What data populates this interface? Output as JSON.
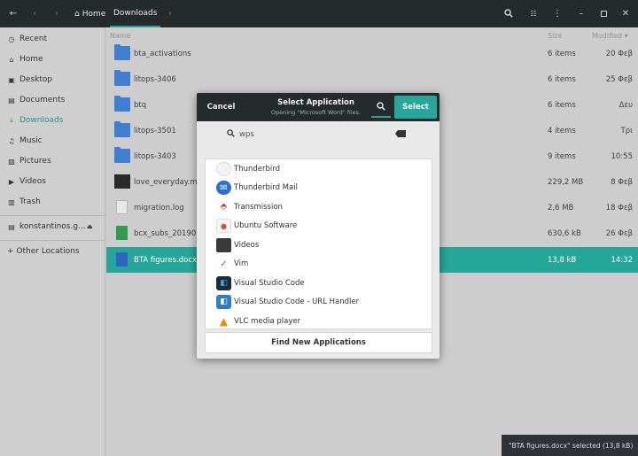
{
  "header": {
    "back_icon": "arrow-left-icon",
    "forward_icon": "arrow-right-icon",
    "crumbs": [
      "Home",
      "Downloads"
    ],
    "actions": [
      "search-icon",
      "view-toggle-icon",
      "menu-icon",
      "minimize-icon",
      "maximize-icon",
      "close-icon"
    ]
  },
  "sidebar": {
    "items": [
      {
        "label": "Recent",
        "icon": "clock-icon"
      },
      {
        "label": "Home",
        "icon": "home-icon"
      },
      {
        "label": "Desktop",
        "icon": "desktop-icon"
      },
      {
        "label": "Documents",
        "icon": "documents-icon"
      },
      {
        "label": "Downloads",
        "icon": "download-icon"
      },
      {
        "label": "Music",
        "icon": "music-icon"
      },
      {
        "label": "Pictures",
        "icon": "pictures-icon"
      },
      {
        "label": "Videos",
        "icon": "videos-icon"
      },
      {
        "label": "Trash",
        "icon": "trash-icon"
      }
    ],
    "drive": {
      "label": "konstantinos.g...",
      "icon": "drive-icon",
      "eject_icon": "eject-icon"
    },
    "other": {
      "label": "+ Other Locations"
    }
  },
  "filelist": {
    "columns": {
      "name": "Name",
      "size": "Size",
      "modified": "Modified ▾"
    },
    "rows": [
      {
        "name": "bta_activations",
        "size": "6 items",
        "modified": "20 Φεβ",
        "kind": "folder"
      },
      {
        "name": "litops-3406",
        "size": "6 items",
        "modified": "25 Φεβ",
        "kind": "folder"
      },
      {
        "name": "btq",
        "size": "6 items",
        "modified": "Δευ",
        "kind": "folder"
      },
      {
        "name": "litops-3501",
        "size": "4 items",
        "modified": "Τρι",
        "kind": "folder"
      },
      {
        "name": "litops-3403",
        "size": "9 items",
        "modified": "10:55",
        "kind": "folder"
      },
      {
        "name": "love_everyday.mp",
        "size": "229,2 MB",
        "modified": "8 Φεβ",
        "kind": "video"
      },
      {
        "name": "migration.log",
        "size": "2,6 MB",
        "modified": "18 Φεβ",
        "kind": "log"
      },
      {
        "name": "bcx_subs_20190",
        "size": "630,6 kB",
        "modified": "26 Φεβ",
        "kind": "sheet"
      },
      {
        "name": "BTA figures.docx",
        "size": "13,8 kB",
        "modified": "14:32",
        "kind": "docx",
        "selected": true
      }
    ]
  },
  "status": "\"BTA figures.docx\" selected  (13,8 kB)",
  "dialog": {
    "cancel": "Cancel",
    "title": "Select Application",
    "subtitle": "Opening \"Microsoft Word\" files.",
    "select": "Select",
    "search_value": "wps",
    "apps": [
      {
        "name": "Thunderbird",
        "icon": "thunderbird-icon"
      },
      {
        "name": "Thunderbird Mail",
        "icon": "thunderbird-mail-icon"
      },
      {
        "name": "Transmission",
        "icon": "transmission-icon"
      },
      {
        "name": "Ubuntu Software",
        "icon": "ubuntu-software-icon"
      },
      {
        "name": "Videos",
        "icon": "videos-app-icon"
      },
      {
        "name": "Vim",
        "icon": "vim-icon"
      },
      {
        "name": "Visual Studio Code",
        "icon": "vscode-icon"
      },
      {
        "name": "Visual Studio Code - URL Handler",
        "icon": "vscode-url-icon"
      },
      {
        "name": "VLC media player",
        "icon": "vlc-icon"
      }
    ],
    "find": "Find New Applications"
  },
  "colors": {
    "accent": "#26a79a",
    "header": "#252a2d",
    "folder": "#3f7fd1"
  }
}
